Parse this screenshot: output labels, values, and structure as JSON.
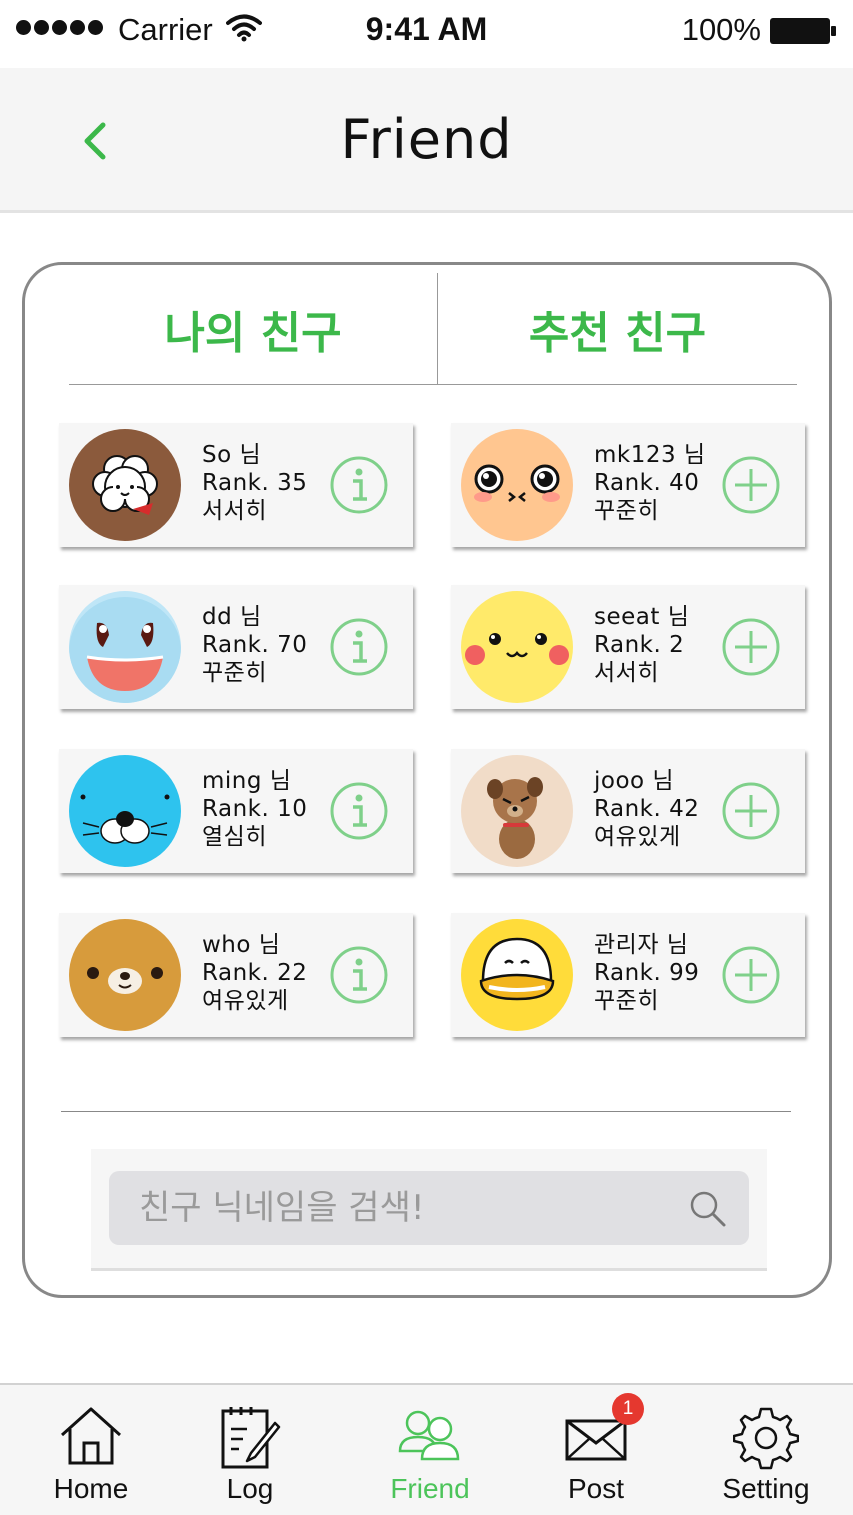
{
  "status_bar": {
    "carrier": "Carrier",
    "time": "9:41 AM",
    "battery": "100%"
  },
  "header": {
    "title": "Friend",
    "back_icon": "chevron-left-icon"
  },
  "tabs": {
    "my_friends": "나의 친구",
    "recommended": "추천 친구"
  },
  "my_friends": [
    {
      "name": "So 님",
      "rank": "Rank. 35",
      "status": "서서히",
      "avatar": "white-bunny-avatar"
    },
    {
      "name": "dd 님",
      "rank": "Rank. 70",
      "status": "꾸준히",
      "avatar": "blue-turtle-avatar"
    },
    {
      "name": "ming 님",
      "rank": "Rank. 10",
      "status": "열심히",
      "avatar": "blue-seal-avatar"
    },
    {
      "name": "who 님",
      "rank": "Rank. 22",
      "status": "여유있게",
      "avatar": "brown-bear-avatar"
    }
  ],
  "recommended_friends": [
    {
      "name": "mk123 님",
      "rank": "Rank. 40",
      "status": "꾸준히",
      "avatar": "peach-face-avatar"
    },
    {
      "name": "seeat 님",
      "rank": "Rank. 2",
      "status": "서서히",
      "avatar": "yellow-face-avatar"
    },
    {
      "name": "jooo 님",
      "rank": "Rank. 42",
      "status": "여유있게",
      "avatar": "brown-dog-avatar"
    },
    {
      "name": "관리자 님",
      "rank": "Rank. 99",
      "status": "꾸준히",
      "avatar": "yellow-duck-avatar"
    }
  ],
  "search": {
    "placeholder": "친구 닉네임을 검색!"
  },
  "tab_bar": {
    "items": [
      {
        "label": "Home",
        "icon": "home-icon"
      },
      {
        "label": "Log",
        "icon": "log-icon"
      },
      {
        "label": "Friend",
        "icon": "friends-icon",
        "active": true
      },
      {
        "label": "Post",
        "icon": "mail-icon",
        "badge": "1"
      },
      {
        "label": "Setting",
        "icon": "gear-icon"
      }
    ]
  },
  "colors": {
    "accent_green": "#3cb84a",
    "badge_red": "#e5382f"
  }
}
